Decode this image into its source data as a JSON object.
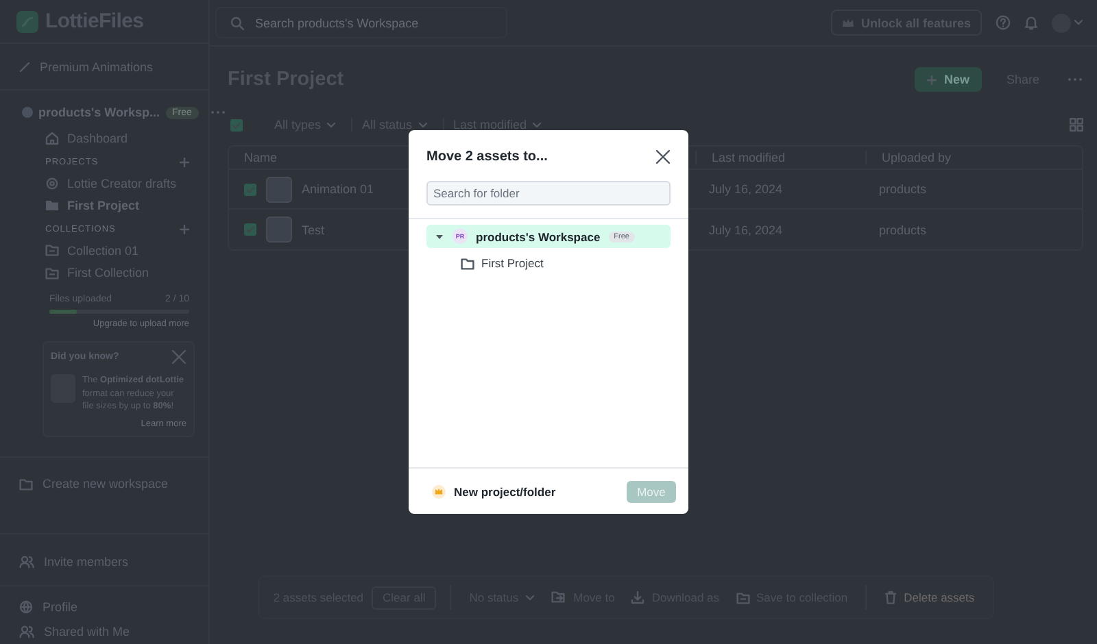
{
  "topbar": {
    "logo": "LottieFiles",
    "search_placeholder": "Search products's Workspace",
    "unlock_button": "Unlock all features"
  },
  "sidebar": {
    "premium": "Premium Animations",
    "workspace": {
      "name": "products's Worksp...",
      "badge": "Free"
    },
    "nav": [
      {
        "label": "Dashboard",
        "selected": false
      }
    ],
    "sections": [
      {
        "heading": "PROJECTS",
        "items": [
          {
            "label": "Lottie Creator drafts",
            "kind": "drafts",
            "selected": false
          },
          {
            "label": "First Project",
            "kind": "folder",
            "selected": true
          }
        ]
      },
      {
        "heading": "COLLECTIONS",
        "items": [
          {
            "label": "Collection 01",
            "kind": "collection",
            "selected": false
          },
          {
            "label": "First Collection",
            "kind": "collection",
            "selected": false
          }
        ]
      }
    ],
    "uploads": {
      "label": "Files uploaded",
      "count": "2 / 10",
      "level": 0.2,
      "upgrade": "Upgrade to upload more"
    },
    "tip": {
      "title": "Did you know?",
      "text": "The **Optimized dotLottie** format can reduce your file sizes by up to **80%**!",
      "link": "Learn more"
    },
    "create_workspace": "Create new workspace",
    "invite": "Invite members",
    "footer_links": [
      {
        "label": "Profile",
        "kind": "globe"
      },
      {
        "label": "Shared with Me",
        "kind": "people"
      }
    ]
  },
  "page": {
    "title": "First Project",
    "new_button": "New",
    "share_button": "Share"
  },
  "filters": {
    "select_all_checked": true,
    "dropdowns": [
      "All types",
      "All status",
      "Last modified"
    ]
  },
  "table": {
    "columns": [
      "Name",
      "Last modified",
      "Uploaded by"
    ],
    "rows": [
      {
        "name": "Animation 01",
        "modified": "July 16, 2024",
        "uploaded_by": "products",
        "checked": true
      },
      {
        "name": "Test",
        "modified": "July 16, 2024",
        "uploaded_by": "products",
        "checked": true
      }
    ]
  },
  "action_bar": {
    "count": "2 assets selected",
    "clear": "Clear all",
    "status": "No status",
    "actions": [
      {
        "label": "Move to",
        "kind": "move"
      },
      {
        "label": "Download as",
        "kind": "download"
      },
      {
        "label": "Save to collection",
        "kind": "collection"
      },
      {
        "label": "Delete assets",
        "kind": "delete"
      }
    ]
  },
  "dialog": {
    "title": "Move 2 assets to...",
    "search_placeholder": "Search for folder",
    "tree": [
      {
        "label": "products's Workspace",
        "initials": "PR",
        "badge": "Free",
        "expanded": true,
        "selected": true,
        "children": [
          {
            "label": "First Project",
            "selected": false
          }
        ]
      }
    ],
    "new_folder": "New project/folder",
    "move_button": {
      "label": "Move",
      "disabled": true
    }
  }
}
